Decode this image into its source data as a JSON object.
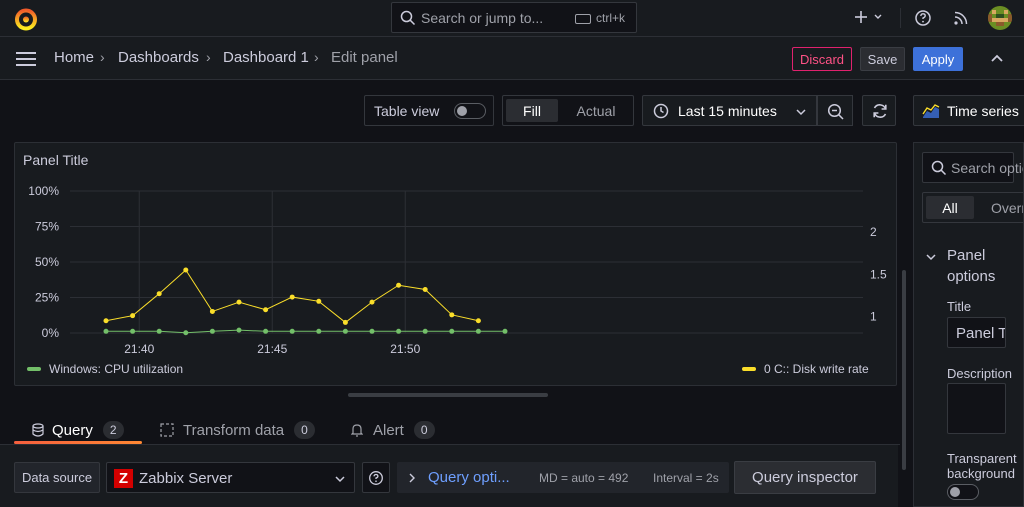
{
  "topbar": {
    "search_placeholder": "Search or jump to...",
    "search_shortcut": "ctrl+k",
    "add_icon": "plus-icon",
    "help_icon": "help-circle-icon",
    "news_icon": "rss-icon"
  },
  "breadcrumb": {
    "items": [
      "Home",
      "Dashboards",
      "Dashboard 1",
      "Edit panel"
    ]
  },
  "actions": {
    "discard": "Discard",
    "save": "Save",
    "apply": "Apply"
  },
  "toolbar": {
    "table_view": "Table view",
    "table_view_on": false,
    "fill": "Fill",
    "actual": "Actual",
    "time_range": "Last 15 minutes",
    "visualization": "Time series"
  },
  "panel": {
    "title": "Panel Title"
  },
  "chart_data": {
    "type": "line",
    "x": [
      "21:38:45",
      "21:39:45",
      "21:40:45",
      "21:41:45",
      "21:42:45",
      "21:43:45",
      "21:44:45",
      "21:45:45",
      "21:46:45",
      "21:47:45",
      "21:48:45",
      "21:49:45",
      "21:50:45",
      "21:51:45",
      "21:52:45",
      "21:53:45"
    ],
    "x_ticks": [
      "21:40",
      "21:45",
      "21:50"
    ],
    "y_left": {
      "ticks": [
        "0%",
        "25%",
        "50%",
        "75%",
        "100%"
      ],
      "range": [
        0,
        100
      ]
    },
    "y_right": {
      "ticks": [
        "1",
        "1.5",
        "2"
      ],
      "range": [
        0.805,
        2.485
      ]
    },
    "series": [
      {
        "name": "Windows: CPU utilization",
        "axis": "left",
        "color": "#73bf69",
        "values": [
          1.2,
          1.2,
          1.2,
          0.2,
          1.2,
          2.0,
          1.2,
          1.2,
          1.2,
          1.2,
          1.2,
          1.2,
          1.2,
          1.2,
          1.2,
          1.2
        ]
      },
      {
        "name": "0 C:: Disk write rate",
        "axis": "right",
        "color": "#fade2a",
        "values": [
          0.95,
          1.01,
          1.27,
          1.55,
          1.06,
          1.17,
          1.08,
          1.23,
          1.18,
          0.93,
          1.17,
          1.37,
          1.32,
          1.02,
          0.95,
          null
        ]
      }
    ],
    "legend_placement": "bottom",
    "grid": true
  },
  "tabs": [
    {
      "label": "Query",
      "count": "2",
      "icon": "database-icon"
    },
    {
      "label": "Transform data",
      "count": "0",
      "icon": "transform-icon"
    },
    {
      "label": "Alert",
      "count": "0",
      "icon": "bell-icon"
    }
  ],
  "query": {
    "data_source_label": "Data source",
    "data_source": "Zabbix Server",
    "query_options": "Query opti...",
    "md": "MD = auto = 492",
    "interval": "Interval = 2s",
    "inspector": "Query inspector"
  },
  "options": {
    "search_placeholder": "Search options",
    "tab_all": "All",
    "tab_overrides": "Overrides",
    "section": "Panel options",
    "title_label": "Title",
    "title_value": "Panel Title",
    "description_label": "Description",
    "transparent_label": "Transparent background"
  }
}
